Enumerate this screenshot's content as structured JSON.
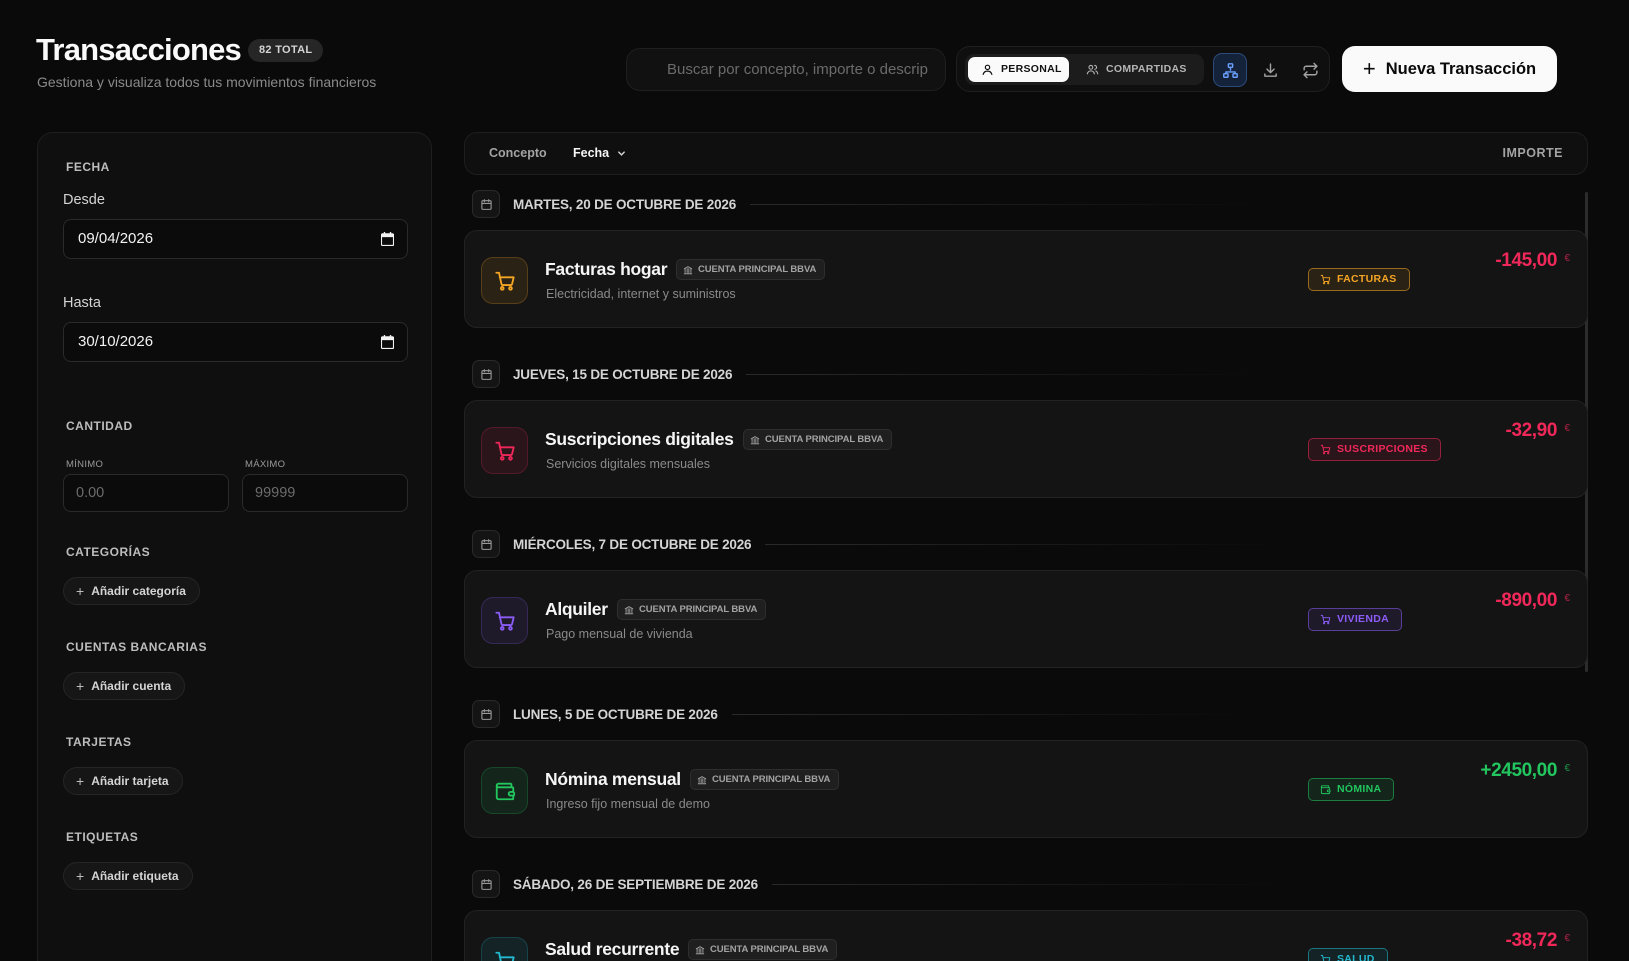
{
  "header": {
    "title": "Transacciones",
    "total_badge": "82 TOTAL",
    "subtitle": "Gestiona y visualiza todos tus movimientos financieros",
    "search_placeholder": "Buscar por concepto, importe o descrip",
    "segment": {
      "personal": "PERSONAL",
      "shared": "COMPARTIDAS",
      "active": "personal"
    },
    "new_button": "Nueva Transacción"
  },
  "filters": {
    "date": {
      "section": "FECHA",
      "from_label": "Desde",
      "from_value": "09/04/2026",
      "to_label": "Hasta",
      "to_value": "30/10/2026"
    },
    "amount": {
      "section": "CANTIDAD",
      "min_label": "MÍNIMO",
      "min_placeholder": "0.00",
      "max_label": "MÁXIMO",
      "max_placeholder": "99999"
    },
    "categories": {
      "section": "CATEGORÍAS",
      "add": "Añadir categoría"
    },
    "accounts": {
      "section": "CUENTAS BANCARIAS",
      "add": "Añadir cuenta"
    },
    "cards": {
      "section": "TARJETAS",
      "add": "Añadir tarjeta"
    },
    "tags": {
      "section": "ETIQUETAS",
      "add": "Añadir etiqueta"
    }
  },
  "list": {
    "columns": {
      "concept": "Concepto",
      "date": "Fecha",
      "amount": "IMPORTE"
    },
    "groups": [
      {
        "date": "MARTES, 20 DE OCTUBRE DE 2026",
        "tx": {
          "name": "Facturas hogar",
          "account": "CUENTA PRINCIPAL BBVA",
          "description": "Electricidad, internet y suministros",
          "category": "FACTURAS",
          "amount": "-145,00",
          "currency": "€",
          "icon": "cart-icon",
          "color": "#f5a524"
        }
      },
      {
        "date": "JUEVES, 15 DE OCTUBRE DE 2026",
        "tx": {
          "name": "Suscripciones digitales",
          "account": "CUENTA PRINCIPAL BBVA",
          "description": "Servicios digitales mensuales",
          "category": "SUSCRIPCIONES",
          "amount": "-32,90",
          "currency": "€",
          "icon": "cart-icon",
          "color": "#f0285a"
        }
      },
      {
        "date": "MIÉRCOLES, 7 DE OCTUBRE DE 2026",
        "tx": {
          "name": "Alquiler",
          "account": "CUENTA PRINCIPAL BBVA",
          "description": "Pago mensual de vivienda",
          "category": "VIVIENDA",
          "amount": "-890,00",
          "currency": "€",
          "icon": "cart-icon",
          "color": "#8b5cf6"
        }
      },
      {
        "date": "LUNES, 5 DE OCTUBRE DE 2026",
        "tx": {
          "name": "Nómina mensual",
          "account": "CUENTA PRINCIPAL BBVA",
          "description": "Ingreso fijo mensual de demo",
          "category": "NÓMINA",
          "amount": "+2450,00",
          "currency": "€",
          "icon": "wallet-icon",
          "color": "#22c55e"
        }
      },
      {
        "date": "SÁBADO, 26 DE SEPTIEMBRE DE 2026",
        "tx": {
          "name": "Salud recurrente",
          "account": "CUENTA PRINCIPAL BBVA",
          "description": "",
          "category": "SALUD",
          "amount": "-38,72",
          "currency": "€",
          "icon": "cart-icon",
          "color": "#22b8cf"
        }
      }
    ]
  },
  "colors": {
    "negative": "#f0285a",
    "positive": "#22c55e",
    "accent_blue": "#6aa0ff"
  }
}
